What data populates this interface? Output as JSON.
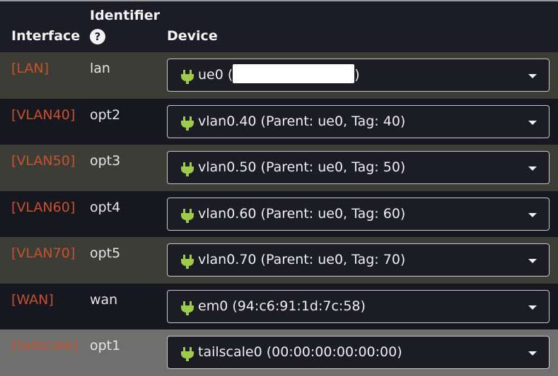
{
  "header": {
    "interface": "Interface",
    "identifier": "Identifier",
    "help": "?",
    "device": "Device"
  },
  "colors": {
    "interface_link": "#c8502c",
    "plug_icon": "#9ccc4a"
  },
  "rows": [
    {
      "interface": "[LAN]",
      "identifier": "lan",
      "device_prefix": "ue0 (",
      "device_suffix": ")",
      "redacted": true,
      "icon": "plug-icon"
    },
    {
      "interface": "[VLAN40]",
      "identifier": "opt2",
      "device": "vlan0.40 (Parent: ue0, Tag: 40)",
      "icon": "plug-icon"
    },
    {
      "interface": "[VLAN50]",
      "identifier": "opt3",
      "device": "vlan0.50 (Parent: ue0, Tag: 50)",
      "icon": "plug-icon"
    },
    {
      "interface": "[VLAN60]",
      "identifier": "opt4",
      "device": "vlan0.60 (Parent: ue0, Tag: 60)",
      "icon": "plug-icon"
    },
    {
      "interface": "[VLAN70]",
      "identifier": "opt5",
      "device": "vlan0.70 (Parent: ue0, Tag: 70)",
      "icon": "plug-icon"
    },
    {
      "interface": "[WAN]",
      "identifier": "wan",
      "device": "em0 (94:c6:91:1d:7c:58)",
      "icon": "plug-icon"
    },
    {
      "interface": "[tailscale]",
      "identifier": "opt1",
      "device": "tailscale0 (00:00:00:00:00:00)",
      "icon": "plug-icon"
    }
  ]
}
